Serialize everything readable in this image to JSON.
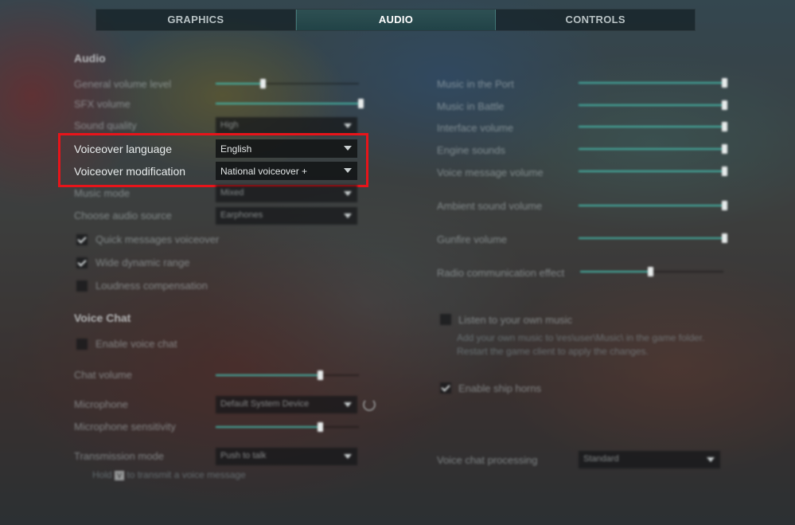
{
  "tabs": [
    {
      "label": "GRAPHICS"
    },
    {
      "label": "AUDIO"
    },
    {
      "label": "CONTROLS"
    }
  ],
  "audio": {
    "title": "Audio",
    "general_volume": {
      "label": "General volume level",
      "value": 0.33
    },
    "sfx_volume": {
      "label": "SFX volume",
      "value": 1.0
    },
    "sound_quality": {
      "label": "Sound quality",
      "value": "High"
    },
    "voiceover_language": {
      "label": "Voiceover language",
      "value": "English"
    },
    "voiceover_modification": {
      "label": "Voiceover modification",
      "value": "National voiceover +"
    },
    "music_mode": {
      "label": "Music mode",
      "value": "Mixed"
    },
    "audio_source": {
      "label": "Choose audio source",
      "value": "Earphones"
    },
    "quick_messages": {
      "label": "Quick messages voiceover",
      "checked": true
    },
    "wide_dynamic": {
      "label": "Wide dynamic range",
      "checked": true
    },
    "loudness": {
      "label": "Loudness compensation",
      "checked": false
    }
  },
  "voice_chat": {
    "title": "Voice Chat",
    "enable": {
      "label": "Enable voice chat",
      "checked": false
    },
    "chat_volume": {
      "label": "Chat volume",
      "value": 0.73
    },
    "microphone": {
      "label": "Microphone",
      "value": "Default System Device"
    },
    "mic_sensitivity": {
      "label": "Microphone sensitivity",
      "value": 0.73
    },
    "transmission": {
      "label": "Transmission mode",
      "value": "Push to talk"
    },
    "hint_pre": "Hold",
    "hint_key": "V",
    "hint_post": "to transmit a voice message"
  },
  "right": {
    "music_port": {
      "label": "Music in the Port",
      "value": 1.0
    },
    "music_battle": {
      "label": "Music in Battle",
      "value": 1.0
    },
    "interface_volume": {
      "label": "Interface volume",
      "value": 1.0
    },
    "engine_sounds": {
      "label": "Engine sounds",
      "value": 1.0
    },
    "voice_message": {
      "label": "Voice message volume",
      "value": 1.0
    },
    "ambient": {
      "label": "Ambient sound volume",
      "value": 1.0
    },
    "gunfire": {
      "label": "Gunfire volume",
      "value": 1.0
    },
    "radio": {
      "label": "Radio communication effect",
      "value": 0.49
    },
    "own_music": {
      "label": "Listen to your own music",
      "checked": false
    },
    "own_music_hint": "Add your own music to \\res\\user\\Music\\ in the game folder. Restart the game client to apply the changes.",
    "ship_horns": {
      "label": "Enable ship horns",
      "checked": true
    },
    "voice_processing": {
      "label": "Voice chat processing",
      "value": "Standard"
    }
  }
}
